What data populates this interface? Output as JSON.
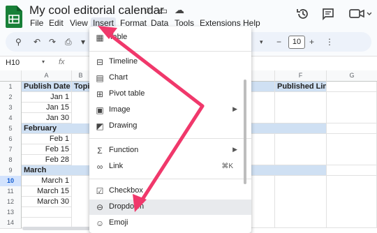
{
  "header": {
    "title": "My cool editorial calendar",
    "menus": [
      "File",
      "Edit",
      "View",
      "Insert",
      "Format",
      "Data",
      "Tools",
      "Extensions",
      "Help"
    ]
  },
  "toolbar": {
    "zoom_value": "10"
  },
  "formula": {
    "name_box": "H10",
    "fx": "fx"
  },
  "grid": {
    "columns": [
      "A",
      "B",
      "F",
      "G"
    ],
    "rows": [
      "1",
      "2",
      "3",
      "4",
      "5",
      "6",
      "7",
      "8",
      "9",
      "10",
      "11",
      "12",
      "13",
      "14"
    ],
    "cells": {
      "a1": "Publish Date",
      "b1": "Topic",
      "f1": "Published Link",
      "a2": "Jan 1",
      "a3": "Jan 15",
      "a4": "Jan 30",
      "a5": "February",
      "a6": "Feb 1",
      "a7": "Feb 15",
      "a8": "Feb 28",
      "a9": "March",
      "a10": "March 1",
      "a11": "March 15",
      "a12": "March 30"
    }
  },
  "insert_menu": {
    "items": {
      "table": "Table",
      "timeline": "Timeline",
      "chart": "Chart",
      "pivot": "Pivot table",
      "image": "Image",
      "drawing": "Drawing",
      "function": "Function",
      "link": "Link",
      "link_shortcut": "⌘K",
      "checkbox": "Checkbox",
      "dropdown": "Dropdown",
      "emoji": "Emoji"
    }
  },
  "colors": {
    "band": "#cfe0f3",
    "arrow": "#f0386b",
    "brand_green": "#188038"
  },
  "icons": [
    "sheets-logo-icon",
    "star-icon",
    "folder-move-icon",
    "cloud-status-icon",
    "history-icon",
    "comment-icon",
    "video-call-icon"
  ]
}
